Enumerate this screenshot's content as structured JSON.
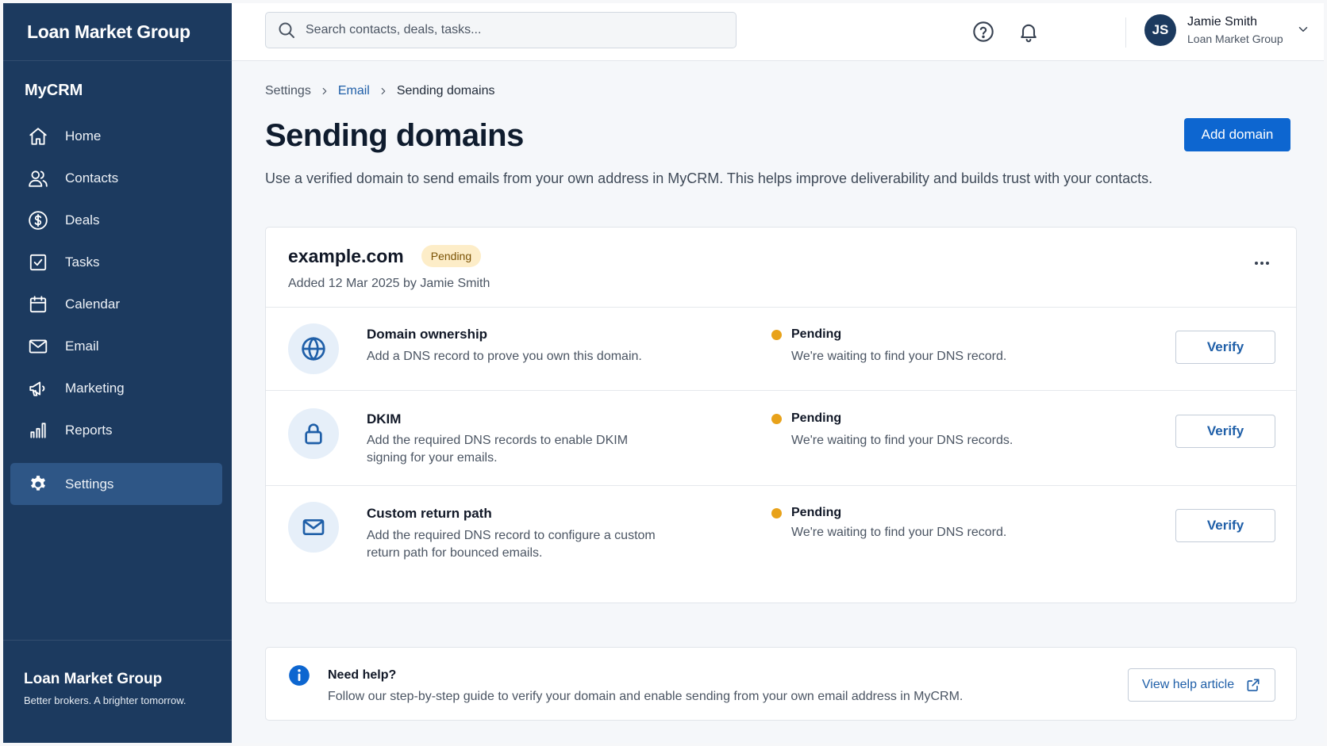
{
  "brand": {
    "name": "Loan Market Group"
  },
  "app": {
    "name": "MyCRM"
  },
  "nav": {
    "items": [
      {
        "label": "Home",
        "icon": "home-icon"
      },
      {
        "label": "Contacts",
        "icon": "contacts-icon"
      },
      {
        "label": "Deals",
        "icon": "dollar-icon"
      },
      {
        "label": "Tasks",
        "icon": "checkbox-icon"
      },
      {
        "label": "Calendar",
        "icon": "calendar-icon"
      },
      {
        "label": "Email",
        "icon": "mail-icon"
      },
      {
        "label": "Marketing",
        "icon": "megaphone-icon"
      },
      {
        "label": "Reports",
        "icon": "bar-chart-icon"
      },
      {
        "label": "Settings",
        "icon": "gear-icon",
        "active": true
      }
    ]
  },
  "footer": {
    "brand": "Loan Market Group",
    "tagline": "Better brokers. A brighter tomorrow."
  },
  "search": {
    "placeholder": "Search contacts, deals, tasks..."
  },
  "user": {
    "initials": "JS",
    "name": "Jamie Smith",
    "org": "Loan Market Group"
  },
  "breadcrumb": [
    "Settings",
    "Email",
    "Sending domains"
  ],
  "page": {
    "title": "Sending domains",
    "description": "Use a verified domain to send emails from your own address in MyCRM. This helps improve deliverability and builds trust with your contacts.",
    "add_button": "Add domain"
  },
  "domain": {
    "name": "example.com",
    "status": "Pending",
    "meta": "Added 12 Mar 2025 by Jamie Smith",
    "checks": [
      {
        "title": "Domain ownership",
        "desc": "Add a DNS record to prove you own this domain.",
        "status": "Pending",
        "status_text": "We're waiting to find your DNS record.",
        "action": "Verify",
        "icon": "globe-icon"
      },
      {
        "title": "DKIM",
        "desc": "Add the required DNS records to enable DKIM signing for your emails.",
        "status": "Pending",
        "status_text": "We're waiting to find your DNS records.",
        "action": "Verify",
        "icon": "lock-icon"
      },
      {
        "title": "Custom return path",
        "desc": "Add the required DNS record to configure a custom return path for bounced emails.",
        "status": "Pending",
        "status_text": "We're waiting to find your DNS record.",
        "action": "Verify",
        "icon": "mail-icon"
      }
    ]
  },
  "help": {
    "title": "Need help?",
    "desc": "Follow our step-by-step guide to verify your domain and enable sending from your own email address in MyCRM.",
    "button": "View help article"
  },
  "colors": {
    "sidebar": "#1c3a5f",
    "active_nav": "#2e5686",
    "primary": "#0d66d0",
    "pending_dot": "#e8a21a",
    "pending_badge": "#fdedc8"
  }
}
